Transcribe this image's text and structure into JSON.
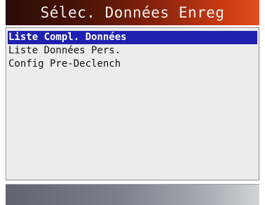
{
  "header": {
    "title": "Sélec. Données Enreg"
  },
  "menu": {
    "items": [
      {
        "label": "Liste Compl. Données",
        "selected": true
      },
      {
        "label": "Liste Données Pers.",
        "selected": false
      },
      {
        "label": "Config Pre-Declench",
        "selected": false
      }
    ]
  },
  "colors": {
    "title_accent": "#c83a14",
    "selection": "#2020b0",
    "panel_background": "#ececec"
  }
}
